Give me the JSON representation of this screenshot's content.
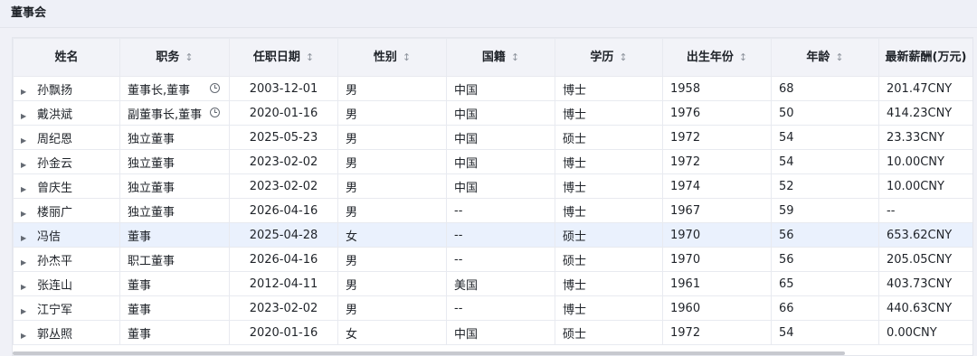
{
  "panel": {
    "title": "董事会"
  },
  "columns": [
    {
      "label": "姓名",
      "sortable": false
    },
    {
      "label": "职务",
      "sortable": true
    },
    {
      "label": "任职日期",
      "sortable": true
    },
    {
      "label": "性别",
      "sortable": true
    },
    {
      "label": "国籍",
      "sortable": true
    },
    {
      "label": "学历",
      "sortable": true
    },
    {
      "label": "出生年份",
      "sortable": true
    },
    {
      "label": "年龄",
      "sortable": true
    },
    {
      "label": "最新薪酬(万元)",
      "sortable": false
    }
  ],
  "rows": [
    {
      "name": "孙飘扬",
      "position": "董事长,董事",
      "history": true,
      "date": "2003-12-01",
      "gender": "男",
      "nationality": "中国",
      "education": "博士",
      "birth_year": "1958",
      "age": "68",
      "salary": "201.47CNY"
    },
    {
      "name": "戴洪斌",
      "position": "副董事长,董事",
      "history": true,
      "date": "2020-01-16",
      "gender": "男",
      "nationality": "中国",
      "education": "博士",
      "birth_year": "1976",
      "age": "50",
      "salary": "414.23CNY"
    },
    {
      "name": "周纪恩",
      "position": "独立董事",
      "history": false,
      "date": "2025-05-23",
      "gender": "男",
      "nationality": "中国",
      "education": "硕士",
      "birth_year": "1972",
      "age": "54",
      "salary": "23.33CNY"
    },
    {
      "name": "孙金云",
      "position": "独立董事",
      "history": false,
      "date": "2023-02-02",
      "gender": "男",
      "nationality": "中国",
      "education": "博士",
      "birth_year": "1972",
      "age": "54",
      "salary": "10.00CNY"
    },
    {
      "name": "曾庆生",
      "position": "独立董事",
      "history": false,
      "date": "2023-02-02",
      "gender": "男",
      "nationality": "中国",
      "education": "博士",
      "birth_year": "1974",
      "age": "52",
      "salary": "10.00CNY"
    },
    {
      "name": "楼丽广",
      "position": "独立董事",
      "history": false,
      "date": "2026-04-16",
      "gender": "男",
      "nationality": "--",
      "education": "博士",
      "birth_year": "1967",
      "age": "59",
      "salary": "--"
    },
    {
      "name": "冯佶",
      "position": "董事",
      "history": false,
      "date": "2025-04-28",
      "gender": "女",
      "nationality": "--",
      "education": "硕士",
      "birth_year": "1970",
      "age": "56",
      "salary": "653.62CNY"
    },
    {
      "name": "孙杰平",
      "position": "职工董事",
      "history": false,
      "date": "2026-04-16",
      "gender": "男",
      "nationality": "--",
      "education": "硕士",
      "birth_year": "1970",
      "age": "56",
      "salary": "205.05CNY"
    },
    {
      "name": "张连山",
      "position": "董事",
      "history": false,
      "date": "2012-04-11",
      "gender": "男",
      "nationality": "美国",
      "education": "博士",
      "birth_year": "1961",
      "age": "65",
      "salary": "403.73CNY"
    },
    {
      "name": "江宁军",
      "position": "董事",
      "history": false,
      "date": "2023-02-02",
      "gender": "男",
      "nationality": "--",
      "education": "博士",
      "birth_year": "1960",
      "age": "66",
      "salary": "440.63CNY"
    },
    {
      "name": "郭丛照",
      "position": "董事",
      "history": false,
      "date": "2020-01-16",
      "gender": "女",
      "nationality": "中国",
      "education": "硕士",
      "birth_year": "1972",
      "age": "54",
      "salary": "0.00CNY"
    }
  ],
  "highlighted_row": 6,
  "icons": {
    "expand": "triangle-right-icon",
    "sort": "sort-updown-icon",
    "history": "clock-icon"
  }
}
